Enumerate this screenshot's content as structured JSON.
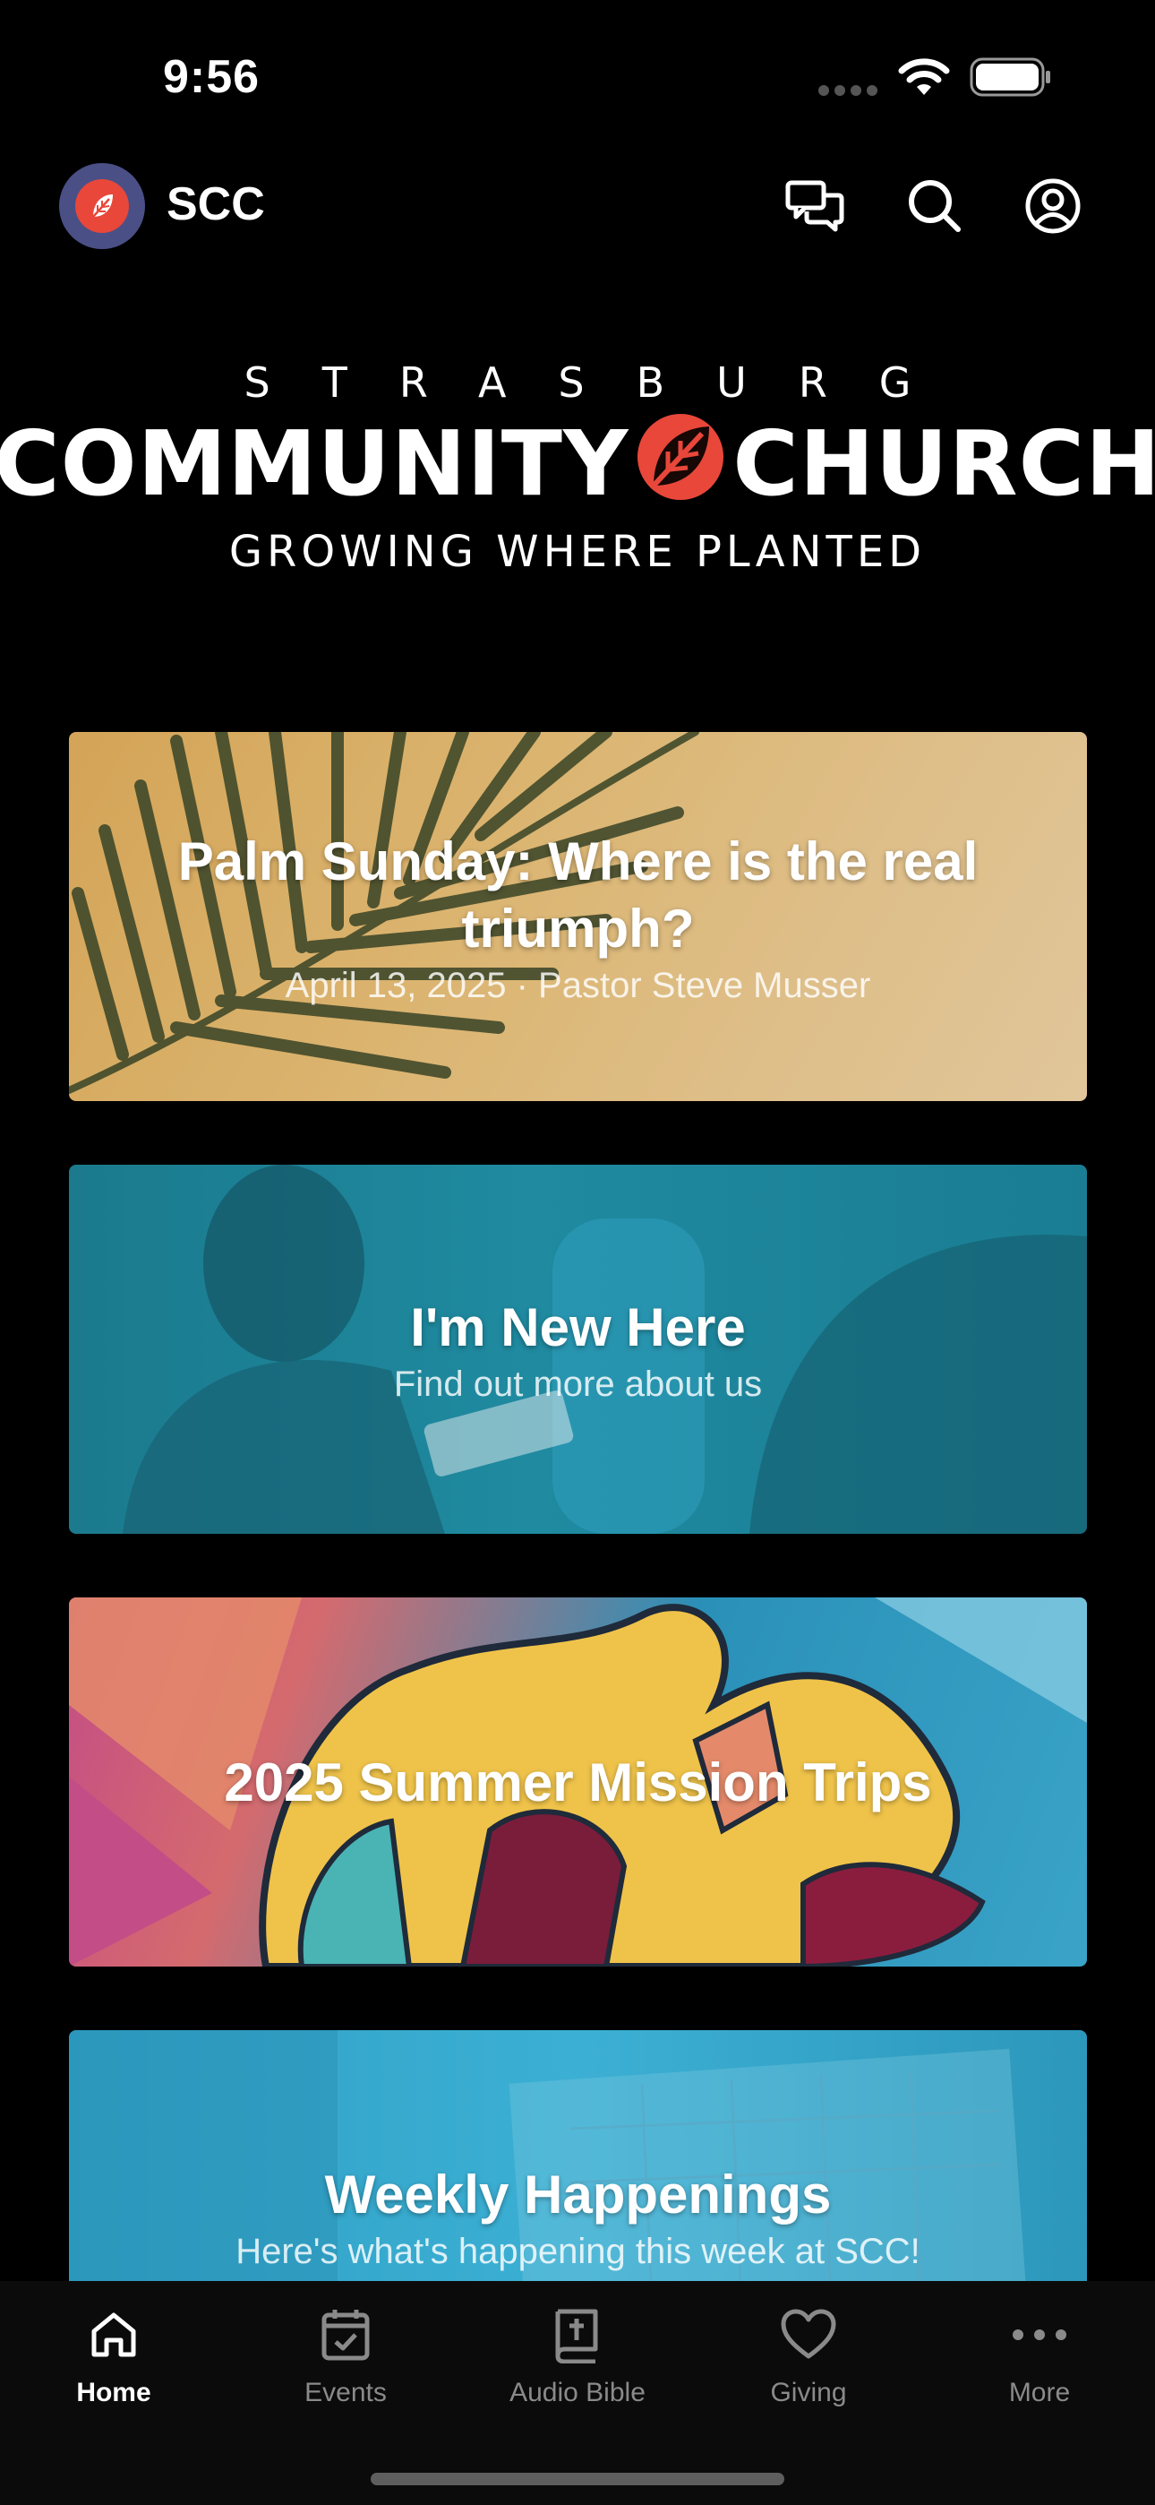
{
  "status_bar": {
    "time": "9:56"
  },
  "header": {
    "app_name": "SCC"
  },
  "logo": {
    "top_line": "STRASBURG",
    "main_left": "COMMUNITY",
    "main_right": "CHURCH",
    "tagline": "GROWING WHERE PLANTED"
  },
  "cards": [
    {
      "title": "Palm Sunday: Where is the real triumph?",
      "subtitle": "April 13, 2025 · Pastor Steve Musser"
    },
    {
      "title": "I'm New Here",
      "subtitle": "Find out more about us"
    },
    {
      "title": "2025 Summer Mission Trips",
      "subtitle": ""
    },
    {
      "title": "Weekly Happenings",
      "subtitle": "Here's what's happening this week at SCC!"
    }
  ],
  "tabs": [
    {
      "label": "Home",
      "icon": "home-icon",
      "active": true
    },
    {
      "label": "Events",
      "icon": "calendar-icon"
    },
    {
      "label": "Audio Bible",
      "icon": "bible-icon"
    },
    {
      "label": "Giving",
      "icon": "heart-icon"
    },
    {
      "label": "More",
      "icon": "more-icon"
    }
  ],
  "colors": {
    "accent": "#e8473a",
    "avatar_bg": "#4a4f86"
  }
}
